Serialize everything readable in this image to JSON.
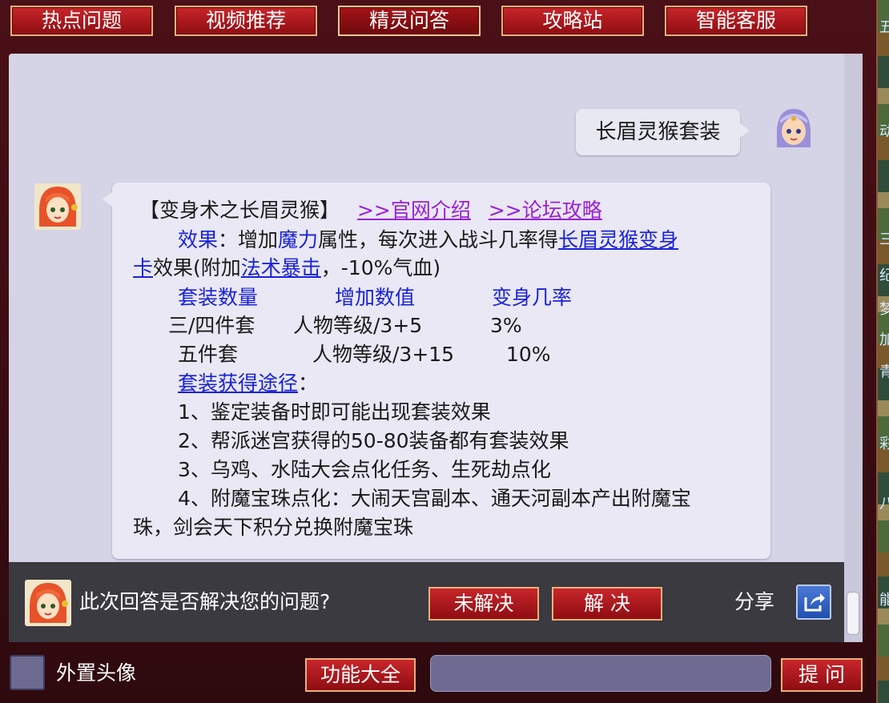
{
  "tabs": [
    {
      "label": "热点问题"
    },
    {
      "label": "视频推荐"
    },
    {
      "label": "精灵问答",
      "active": true
    },
    {
      "label": "攻略站"
    },
    {
      "label": "智能客服"
    }
  ],
  "user_message": "长眉灵猴套装",
  "answer": {
    "title": "【变身术之长眉灵猴】",
    "link_official": ">>官网介绍",
    "link_forum": ">>论坛攻略",
    "effect_label": "效果",
    "effect_text_1": "：增加",
    "effect_magic": "魔力",
    "effect_text_2": "属性，每次进入战斗几率得",
    "effect_card_a": "长眉灵猴变身",
    "effect_card_b": "卡",
    "effect_text_3": "效果(附加",
    "effect_crit": "法术暴击",
    "effect_text_4": "，-10%气血)",
    "table_headers": [
      "套装数量",
      "增加数值",
      "变身几率"
    ],
    "table_rows": [
      [
        "三/四件套",
        "人物等级/3+5",
        "3%"
      ],
      [
        "五件套",
        "人物等级/3+15",
        "10%"
      ]
    ],
    "source_label": "套装获得途径",
    "source_colon": "：",
    "sources": [
      "1、鉴定装备时即可能出现套装效果",
      "2、帮派迷宫获得的50-80装备都有套装效果",
      "3、乌鸡、水陆大会点化任务、生死劫点化",
      "4、附魔宝珠点化：大闹天宫副本、通天河副本产出附魔宝"
    ],
    "sources_cont": "珠，剑会天下积分兑换附魔宝珠"
  },
  "feedback": {
    "question": "此次回答是否解决您的问题?",
    "unsolved": "未解决",
    "solved": "解 决",
    "share": "分享"
  },
  "bottom": {
    "avatar_label": "外置头像",
    "functions": "功能大全",
    "ask": "提 问",
    "input_value": ""
  },
  "right_strip_glyphs": [
    "五",
    "动",
    "三",
    "纪",
    "梦",
    "加",
    "青",
    "彩",
    "八",
    "能"
  ],
  "colors": {
    "tab_red": "#b31a1f",
    "link_blue": "#1a22d8",
    "link_purple": "#9a1fd8",
    "chat_bg": "#d5d3e6",
    "bubble_bg": "#e9e8f4"
  },
  "icons": [
    "assistant-avatar-icon",
    "user-avatar-icon",
    "share-icon"
  ]
}
